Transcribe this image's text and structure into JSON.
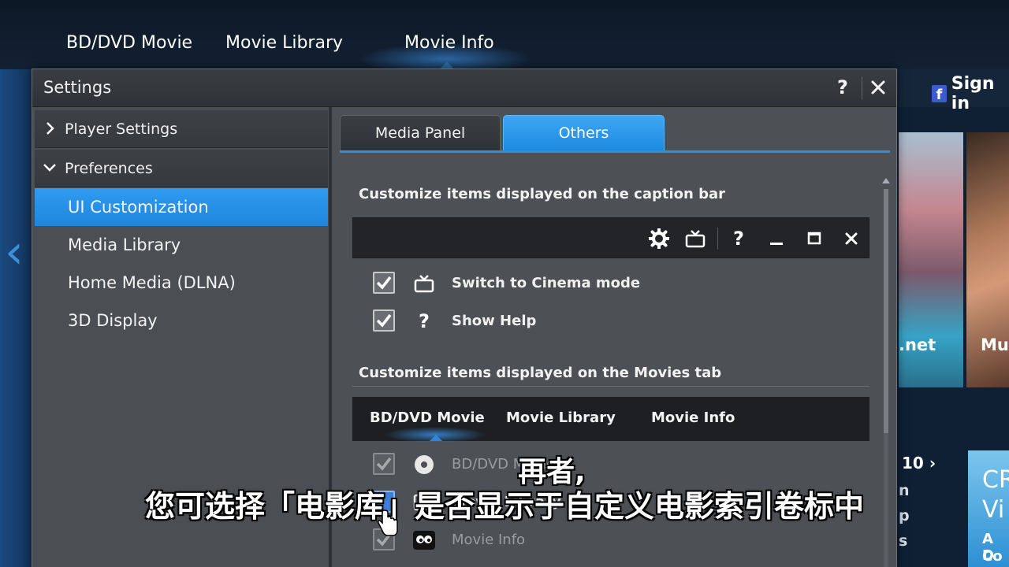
{
  "top_nav": {
    "items": [
      "BD/DVD Movie",
      "Movie Library",
      "Movie Info"
    ],
    "active_index": 2
  },
  "background": {
    "signin_label": "Sign in",
    "thumb_labels": [
      ".net",
      "Mu"
    ],
    "page_count": "10",
    "side_letters": [
      "n",
      "p",
      "s"
    ],
    "promo_lines": [
      "CR",
      "Vi",
      "A D",
      "Co"
    ]
  },
  "dialog": {
    "title": "Settings",
    "help_label": "?",
    "tree": {
      "groups": [
        {
          "label": "Player Settings",
          "expanded": false
        },
        {
          "label": "Preferences",
          "expanded": true
        }
      ],
      "items": [
        "UI Customization",
        "Media Library",
        "Home Media (DLNA)",
        "3D Display"
      ],
      "selected_index": 0
    },
    "tabs": [
      {
        "label": "Media Panel",
        "active": false
      },
      {
        "label": "Others",
        "active": true
      }
    ],
    "caption_section": {
      "title": "Customize items displayed on the caption bar",
      "bar_icons": [
        "gear-icon",
        "tv-icon",
        "help-icon",
        "minimize-icon",
        "maximize-icon",
        "close-icon"
      ],
      "rows": [
        {
          "label": "Switch to Cinema mode",
          "checked": true,
          "icon": "tv-icon"
        },
        {
          "label": "Show Help",
          "checked": true,
          "icon": "help-icon"
        }
      ]
    },
    "movies_section": {
      "title": "Customize items displayed on the Movies tab",
      "tabs": [
        "BD/DVD Movie",
        "Movie Library",
        "Movie Info"
      ],
      "active_tab_index": 0,
      "rows": [
        {
          "label": "BD/DVD Movie",
          "checked": true,
          "icon": "disc-icon",
          "disabled": true
        },
        {
          "label": "Movie Library",
          "checked": false,
          "icon": "library-icon",
          "disabled": false
        },
        {
          "label": "Movie Info",
          "checked": true,
          "icon": "eyes-icon",
          "disabled": true
        }
      ]
    }
  },
  "subtitles": {
    "line1": "再者,",
    "line2": "您可选择「电影库」是否显示于自定义电影索引卷标中"
  },
  "colors": {
    "accent": "#2a8fe3",
    "dialog_bg": "#4a4d52",
    "caption_bar": "#222427"
  }
}
